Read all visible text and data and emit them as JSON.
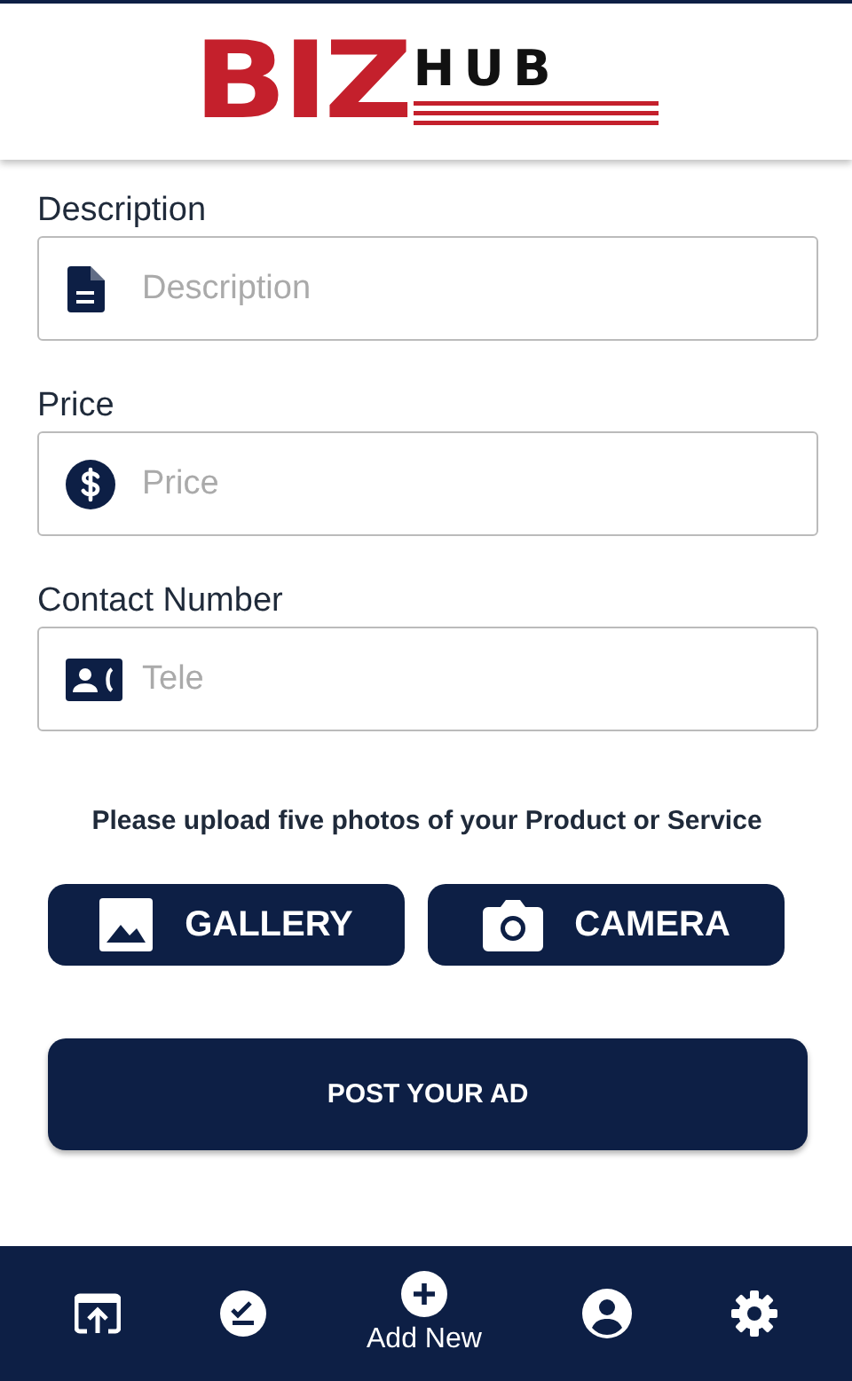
{
  "header": {
    "logo": {
      "part_1": "BIZ",
      "part_2": "HUB"
    }
  },
  "fields": [
    {
      "label": "Description",
      "placeholder": "Description",
      "kind": "document"
    },
    {
      "label": "Price",
      "placeholder": "Price",
      "kind": "dollar"
    },
    {
      "label": "Contact Number",
      "placeholder": "Tele",
      "kind": "contact"
    }
  ],
  "upload_note": "Please upload five photos of your Product or Service",
  "photo_buttons": [
    {
      "label": "GALLERY",
      "kind": "image"
    },
    {
      "label": "CAMERA",
      "kind": "camera"
    }
  ],
  "submit_button": "POST YOUR AD",
  "bottom_nav": [
    {
      "kind": "upload"
    },
    {
      "kind": "tasks"
    },
    {
      "kind": "add",
      "label": "Add New"
    },
    {
      "kind": "profile"
    },
    {
      "kind": "settings"
    }
  ]
}
